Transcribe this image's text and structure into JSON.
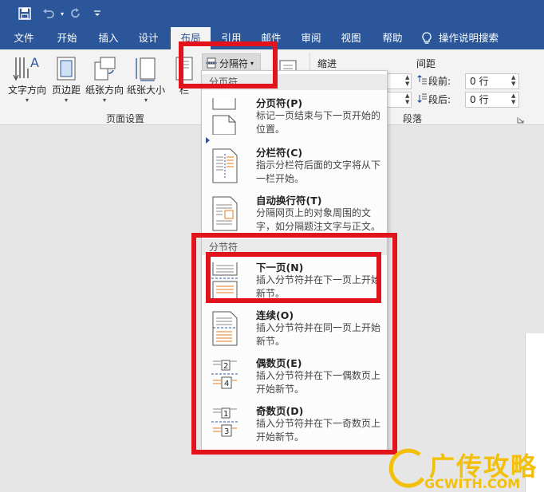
{
  "quick_access": {
    "save_icon": "save-icon",
    "undo_icon": "undo-icon",
    "redo_icon": "redo-icon",
    "customize_icon": "customize-qat-icon"
  },
  "tabs": [
    {
      "label": "文件"
    },
    {
      "label": "开始"
    },
    {
      "label": "插入"
    },
    {
      "label": "设计"
    },
    {
      "label": "布局"
    },
    {
      "label": "引用"
    },
    {
      "label": "邮件"
    },
    {
      "label": "审阅"
    },
    {
      "label": "视图"
    },
    {
      "label": "帮助"
    }
  ],
  "tell_me": {
    "label": "操作说明搜索",
    "icon": "lightbulb-icon"
  },
  "ribbon": {
    "text_direction": "文字方向",
    "margins": "页边距",
    "orientation": "纸张方向",
    "size": "纸张大小",
    "columns": "栏",
    "breaks": "分隔符",
    "page_setup_group": "页面设置",
    "indent_label": "缩进",
    "spacing_label": "间距",
    "before_label": "段前:",
    "before_value": "0 行",
    "after_label": "段后:",
    "after_value": "0 行",
    "paragraph_group": "段落"
  },
  "breaks_menu": {
    "page_breaks_header": "分页符",
    "section_breaks_header": "分节符",
    "items": [
      {
        "title": "分页符(P)",
        "desc": "标记一页结束与下一页开始的位置。"
      },
      {
        "title": "分栏符(C)",
        "desc": "指示分栏符后面的文字将从下一栏开始。"
      },
      {
        "title": "自动换行符(T)",
        "desc": "分隔网页上的对象周围的文字，如分隔题注文字与正文。"
      },
      {
        "title": "下一页(N)",
        "desc": "插入分节符并在下一页上开始新节。"
      },
      {
        "title": "连续(O)",
        "desc": "插入分节符并在同一页上开始新节。"
      },
      {
        "title": "偶数页(E)",
        "desc": "插入分节符并在下一偶数页上开始新节。"
      },
      {
        "title": "奇数页(D)",
        "desc": "插入分节符并在下一奇数页上开始新节。"
      }
    ]
  },
  "watermark": {
    "text": "广传攻略",
    "sub": "GCWITH.COM"
  },
  "colors": {
    "title_bar": "#2b579a",
    "highlight": "#e3131d",
    "accent_orange": "#e07b1f",
    "watermark": "#f2c00a"
  }
}
